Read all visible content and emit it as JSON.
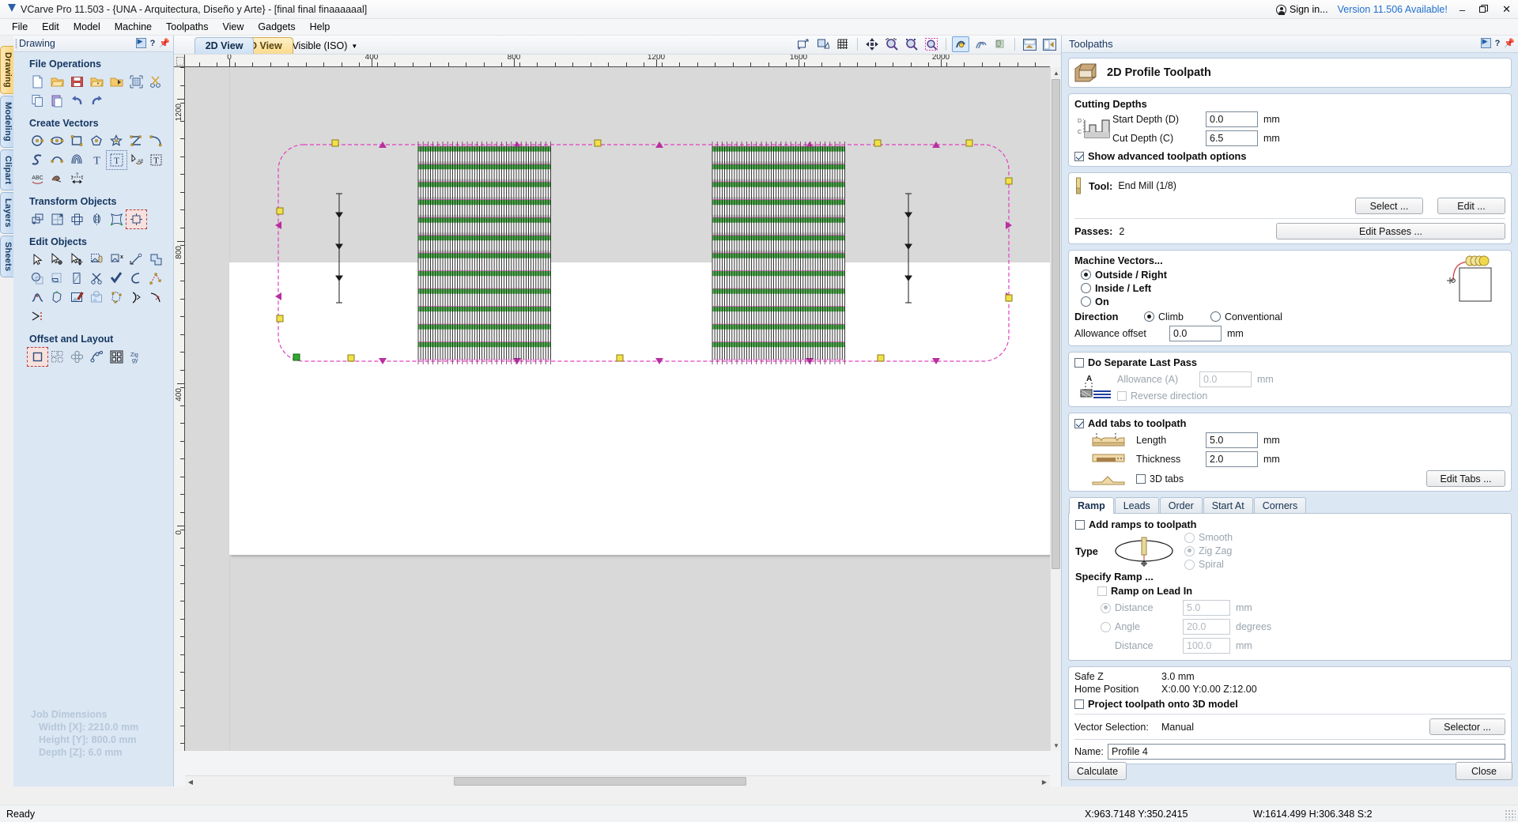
{
  "titlebar": {
    "app_title": "VCarve Pro 11.503 - {UNA - Arquitectura, Diseño y Arte} - [final final finaaaaaal]",
    "logo_icon": "vectric-logo-icon",
    "signin_label": "Sign in...",
    "signin_icon": "user-circle-icon",
    "version_label": "Version 11.506 Available!",
    "minimize": "–",
    "restore": "❐",
    "close": "✕"
  },
  "menubar": {
    "items": [
      "File",
      "Edit",
      "Model",
      "Machine",
      "Toolpaths",
      "View",
      "Gadgets",
      "Help"
    ]
  },
  "left_tabs": [
    {
      "label": "Drawing",
      "active": true
    },
    {
      "label": "Modeling",
      "active": false
    },
    {
      "label": "Clipart",
      "active": false
    },
    {
      "label": "Layers",
      "active": false
    },
    {
      "label": "Sheets",
      "active": false
    }
  ],
  "left_panel": {
    "header": "Drawing",
    "header_icons": [
      "collapse-arrow-icon",
      "help-icon",
      "pin-icon"
    ],
    "sections": [
      {
        "title": "File Operations",
        "icons": [
          "new-file-icon",
          "open-folder-icon",
          "save-icon",
          "open-recent-icon",
          "import-folder-icon",
          "job-setup-icon",
          "cut-scissors-icon",
          "copy-icon",
          "paste-icon",
          "undo-icon",
          "redo-icon"
        ]
      },
      {
        "title": "Create Vectors",
        "icons": [
          "circle-icon",
          "ellipse-icon",
          "rectangle-icon",
          "polygon-icon",
          "star-icon",
          "polyline-icon",
          "arc-icon",
          "curve-icon",
          "draw-curve-icon",
          "spiral-icon",
          "text-icon",
          "text-selected-icon",
          "text-on-curve-icon",
          "text-frame-icon",
          "text-arc-icon",
          "trace-bitmap-icon",
          "dimension-icon"
        ]
      },
      {
        "title": "Transform Objects",
        "icons": [
          "move-icon",
          "scale-icon",
          "rotate-icon",
          "mirror-icon",
          "distort-icon",
          "align-selected-icon"
        ]
      },
      {
        "title": "Edit Objects",
        "icons": [
          "select-arrow-icon",
          "node-edit-icon",
          "move-nodes-icon",
          "group-icon",
          "ungroup-icon",
          "join-vectors-icon",
          "weld-icon",
          "subtract-icon",
          "trim-icon",
          "fillet-icon",
          "cut-vectors-icon",
          "check-geometry-icon",
          "nest-icon",
          "node-points-icon",
          "smooth-curve-icon",
          "close-vectors-icon",
          "edit-bitmap-icon",
          "crop-bitmap-icon",
          "point-editor-icon",
          "fit-curve-icon",
          "fit-arc-icon",
          "fit-line-icon"
        ]
      },
      {
        "title": "Offset and Layout",
        "icons": [
          "offset-selected-icon",
          "array-copy-icon",
          "block-copy-icon",
          "copy-along-curve-icon",
          "nesting-icon",
          "ziggy-icon"
        ]
      }
    ],
    "job_dimensions": {
      "title": "Job Dimensions",
      "width": "Width  [X]: 2210.0 mm",
      "height": "Height [Y]: 800.0 mm",
      "depth": "Depth  [Z]: 6.0 mm"
    }
  },
  "view_bar": {
    "tab_2d": "2D View",
    "tab_3d": "3D View",
    "visible_iso": "Visible (ISO)",
    "visible_iso_icon": "layers-stack-icon",
    "dropdown_icon": "chevron-down-icon",
    "tool_icons": [
      {
        "name": "zoom-scale-icon",
        "active": false
      },
      {
        "name": "zoom-selection-icon",
        "active": false
      },
      {
        "name": "toggle-grid-icon",
        "active": false
      },
      {
        "name": "pan-icon",
        "active": false
      },
      {
        "name": "zoom-extents-icon",
        "active": false
      },
      {
        "name": "zoom-window-icon",
        "active": false
      },
      {
        "name": "zoom-selected-icon",
        "active": false
      },
      {
        "name": "toggle-vectors-icon",
        "active": true
      },
      {
        "name": "toggle-toolpaths-icon",
        "active": false
      },
      {
        "name": "toggle-solid-icon",
        "active": false
      },
      {
        "name": "split-view-horizontal-icon",
        "active": false
      },
      {
        "name": "split-view-vertical-icon",
        "active": false
      }
    ]
  },
  "rulers": {
    "h_labels": [
      "0",
      "400",
      "800",
      "1200",
      "1600",
      "2000"
    ],
    "v_labels": [
      "1200",
      "800",
      "400",
      "0"
    ],
    "units": "mm"
  },
  "right_panel": {
    "header": "Toolpaths",
    "header_icons": [
      "collapse-arrow-icon",
      "help-icon",
      "pin-icon"
    ],
    "toolpath_type": {
      "icon": "profile-toolpath-icon",
      "title": "2D Profile Toolpath"
    },
    "cutting_depths": {
      "title": "Cutting Depths",
      "icon": "depth-profile-icon",
      "start_depth_label": "Start Depth (D)",
      "start_depth_value": "0.0",
      "start_depth_unit": "mm",
      "cut_depth_label": "Cut Depth (C)",
      "cut_depth_value": "6.5",
      "cut_depth_unit": "mm",
      "show_advanced_label": "Show advanced toolpath options",
      "show_advanced_checked": true
    },
    "tool": {
      "icon": "end-mill-icon",
      "label": "Tool:",
      "value": "End Mill (1/8)",
      "select_button": "Select ...",
      "edit_button": "Edit ...",
      "passes_label": "Passes:",
      "passes_value": "2",
      "edit_passes_button": "Edit Passes ..."
    },
    "machine_vectors": {
      "title": "Machine Vectors...",
      "preview_icon": "outside-right-preview-icon",
      "options": [
        {
          "label": "Outside / Right",
          "selected": true
        },
        {
          "label": "Inside / Left",
          "selected": false
        },
        {
          "label": "On",
          "selected": false
        }
      ],
      "direction_label": "Direction",
      "direction_options": [
        {
          "label": "Climb",
          "selected": true
        },
        {
          "label": "Conventional",
          "selected": false
        }
      ],
      "allowance_label": "Allowance offset",
      "allowance_value": "0.0",
      "allowance_unit": "mm"
    },
    "separate_last_pass": {
      "title": "Do Separate Last Pass",
      "checked": false,
      "icon": "last-pass-icon",
      "allowance_label": "Allowance (A)",
      "allowance_value": "0.0",
      "allowance_unit": "mm",
      "reverse_label": "Reverse direction",
      "reverse_checked": false
    },
    "tabs": {
      "title": "Add tabs to toolpath",
      "checked": true,
      "length_label": "Length",
      "length_value": "5.0",
      "length_unit": "mm",
      "length_icon": "tab-length-icon",
      "thickness_label": "Thickness",
      "thickness_value": "2.0",
      "thickness_unit": "mm",
      "thickness_icon": "tab-thickness-icon",
      "three_d_label": "3D tabs",
      "three_d_checked": false,
      "three_d_icon": "tab-3d-icon",
      "edit_tabs_button": "Edit Tabs ..."
    },
    "sub_tabs": [
      {
        "label": "Ramp",
        "active": true
      },
      {
        "label": "Leads",
        "active": false
      },
      {
        "label": "Order",
        "active": false
      },
      {
        "label": "Start At",
        "active": false
      },
      {
        "label": "Corners",
        "active": false
      }
    ],
    "ramp": {
      "add_ramps_label": "Add ramps to toolpath",
      "add_ramps_checked": false,
      "type_label": "Type",
      "type_icon": "ramp-type-icon",
      "type_options": [
        {
          "label": "Smooth",
          "selected": false
        },
        {
          "label": "Zig Zag",
          "selected": true
        },
        {
          "label": "Spiral",
          "selected": false
        }
      ],
      "specify_label": "Specify Ramp ...",
      "lead_in_label": "Ramp on Lead In",
      "lead_in_checked": false,
      "distance_label": "Distance",
      "distance_value": "5.0",
      "distance_unit": "mm",
      "distance_selected": true,
      "angle_label": "Angle",
      "angle_value": "20.0",
      "angle_unit": "degrees",
      "angle_selected": false,
      "distance2_label": "Distance",
      "distance2_value": "100.0",
      "distance2_unit": "mm"
    },
    "position": {
      "safe_z_label": "Safe Z",
      "safe_z_value": "3.0 mm",
      "home_label": "Home Position",
      "home_value": "X:0.00 Y:0.00 Z:12.00",
      "project_label": "Project toolpath onto 3D model",
      "project_checked": false,
      "vector_selection_label": "Vector Selection:",
      "vector_selection_value": "Manual",
      "selector_button": "Selector ...",
      "name_label": "Name:",
      "name_value": "Profile 4"
    },
    "footer": {
      "calculate_button": "Calculate",
      "close_button": "Close"
    }
  },
  "statusbar": {
    "ready": "Ready",
    "coords": "X:963.7148 Y:350.2415",
    "size": "W:1614.499  H:306.348  S:2"
  },
  "colors": {
    "panel_blue": "#dce7f4",
    "accent_blue": "#1f6fd0",
    "toolpath_magenta": "#e040c0",
    "vector_green": "#00a000",
    "tab_yellow": "#f2d35c",
    "canvas_gray": "#d9d9d9",
    "material_white": "#ffffff"
  }
}
